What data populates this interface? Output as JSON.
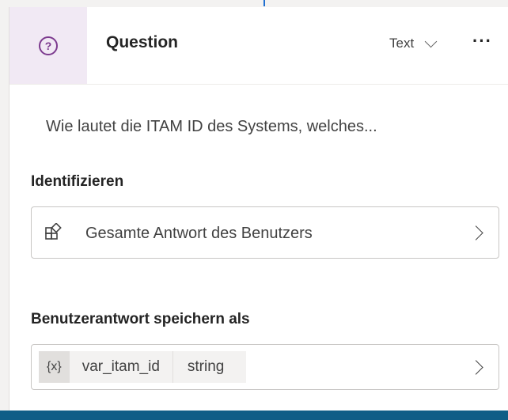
{
  "node": {
    "title": "Question",
    "type_selector": "Text",
    "more_label": "···",
    "prompt": "Wie lautet die ITAM ID des Systems, welches..."
  },
  "identify": {
    "label": "Identifizieren",
    "value": "Gesamte Antwort des Benutzers"
  },
  "save_as": {
    "label": "Benutzerantwort speichern als",
    "var_icon": "{x}",
    "var_name": "var_itam_id",
    "var_type": "string"
  },
  "icons": {
    "header": "question-circle-icon",
    "entity": "entity-icon",
    "variable": "variable-icon"
  },
  "colors": {
    "accent": "#7c3a8e",
    "header_bg": "#f1e9f4",
    "bottom_bar": "#0f5d87"
  }
}
